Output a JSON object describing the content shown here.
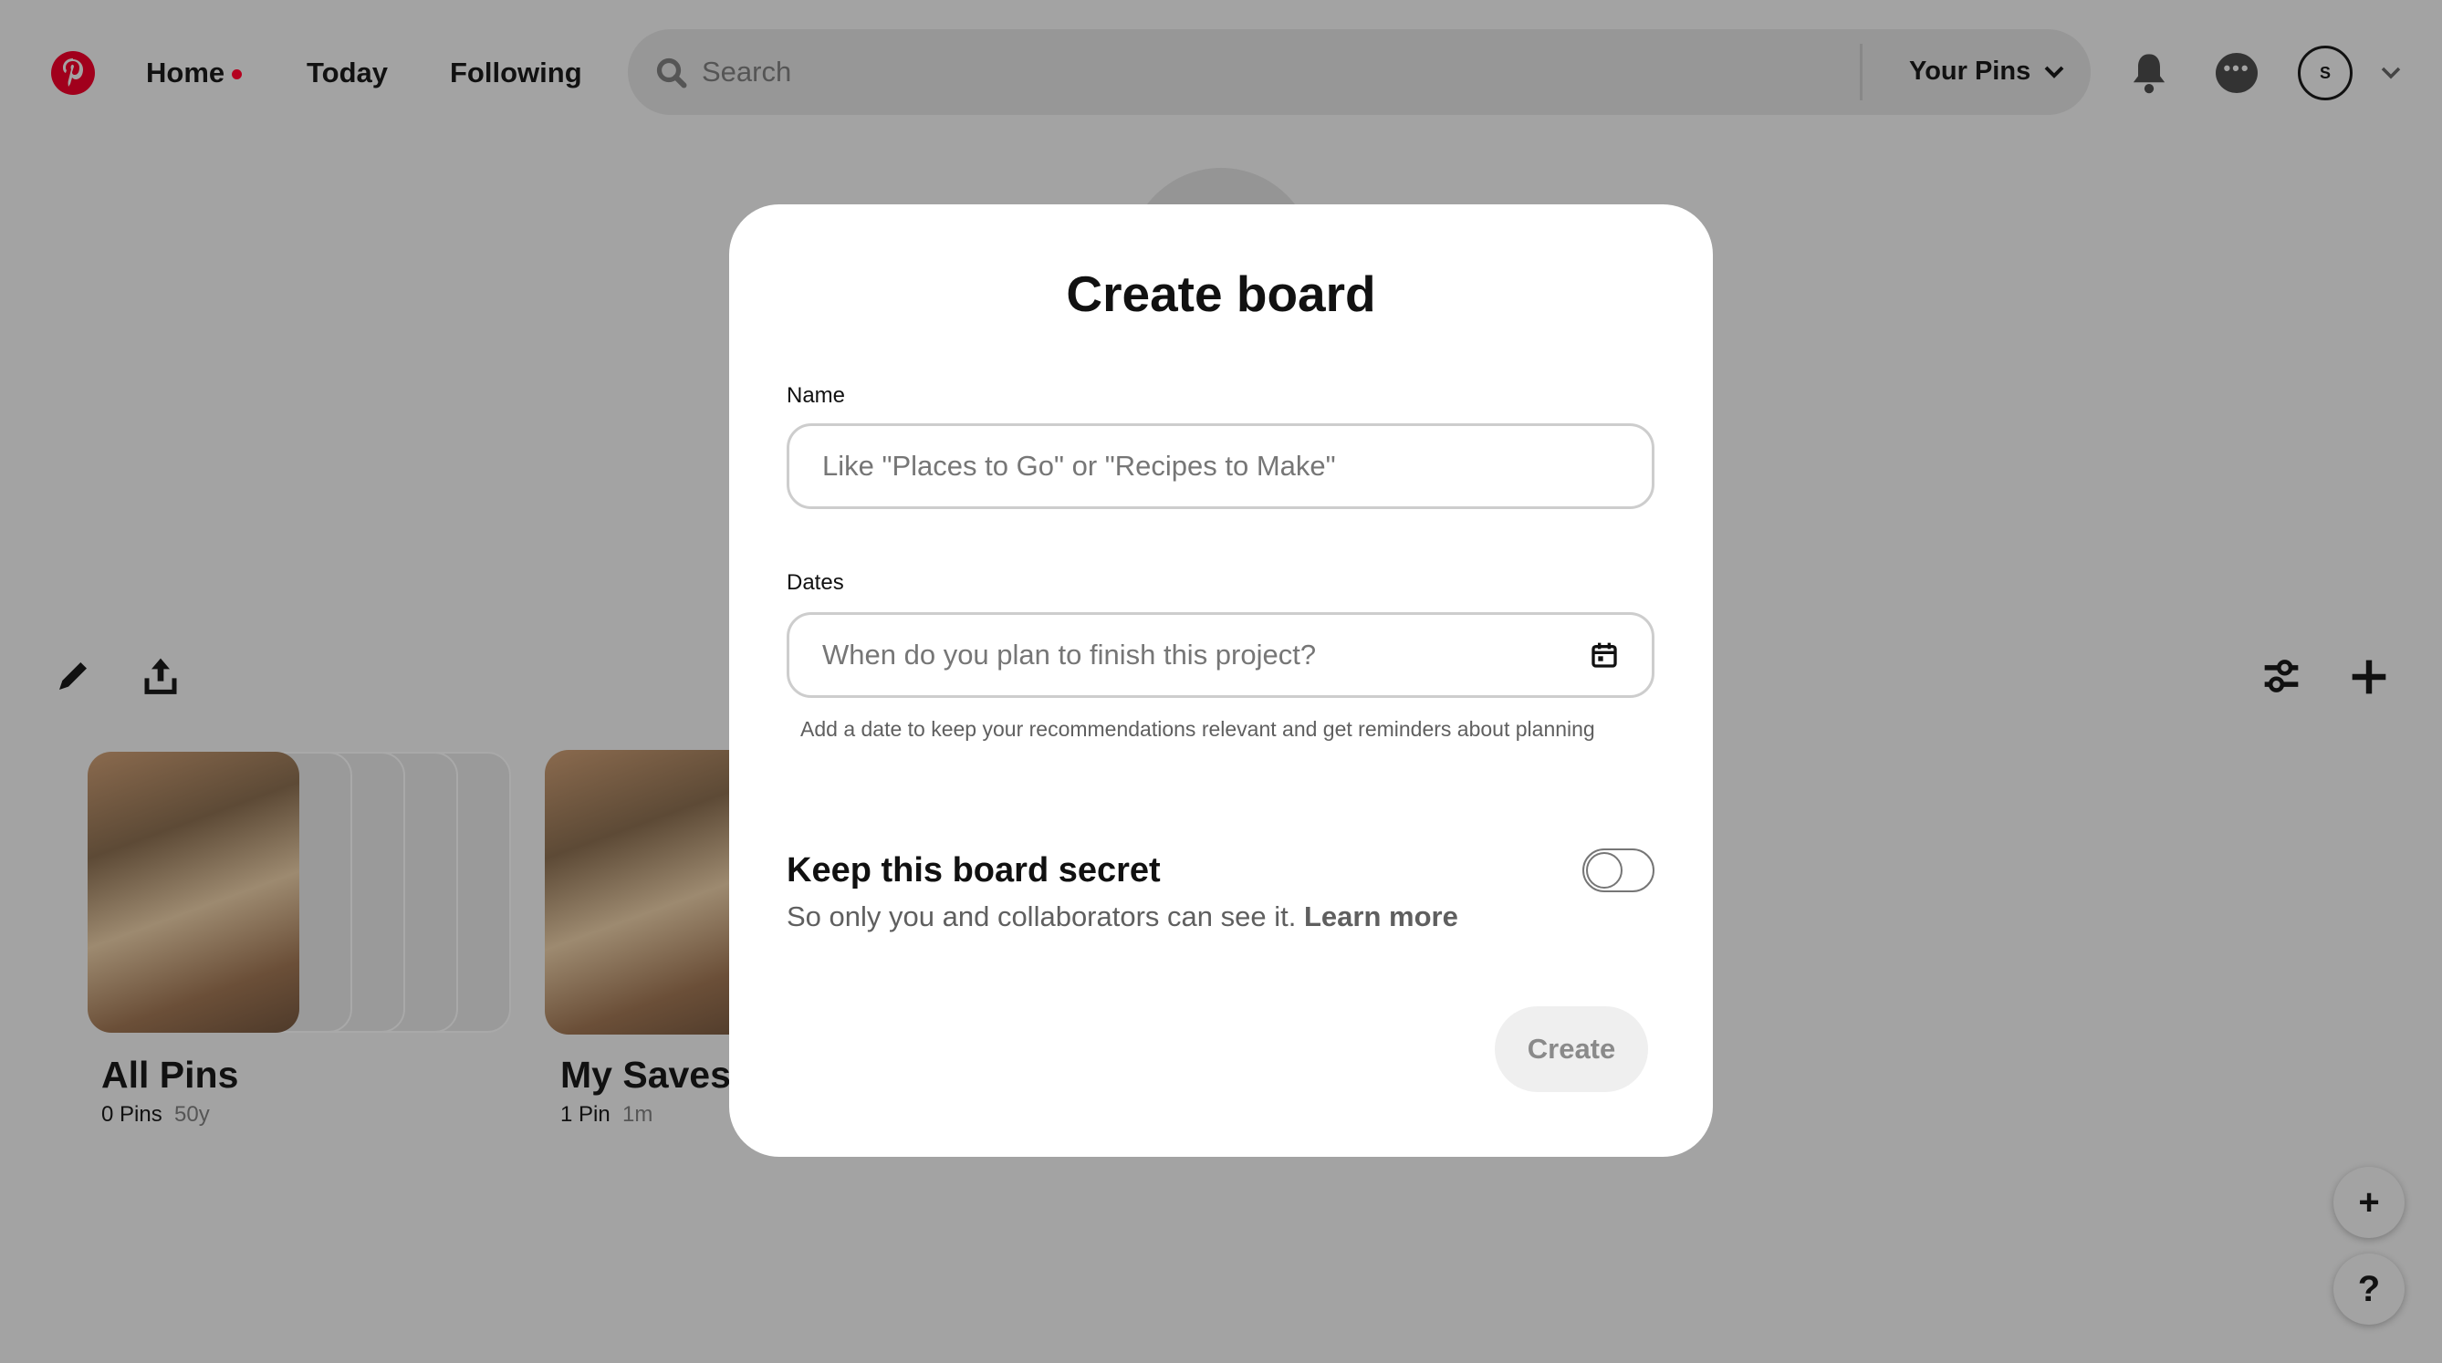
{
  "header": {
    "nav": [
      "Home",
      "Today",
      "Following"
    ],
    "search_placeholder": "Search",
    "your_pins": "Your Pins",
    "avatar_initial": "S",
    "brand_color": "#b5001f"
  },
  "boards": [
    {
      "title": "All Pins",
      "count": "0 Pins",
      "age": "50y"
    },
    {
      "title": "My Saves",
      "count": "1 Pin",
      "age": "1m"
    }
  ],
  "modal": {
    "title": "Create board",
    "name_label": "Name",
    "name_placeholder": "Like \"Places to Go\" or \"Recipes to Make\"",
    "dates_label": "Dates",
    "dates_placeholder": "When do you plan to finish this project?",
    "dates_helper": "Add a date to keep your recommendations relevant and get reminders about planning",
    "secret_title": "Keep this board secret",
    "secret_desc": "So only you and collaborators can see it.",
    "learn_more": "Learn more",
    "secret_on": false,
    "create_label": "Create"
  },
  "fab": {
    "add": "+",
    "help": "?"
  }
}
